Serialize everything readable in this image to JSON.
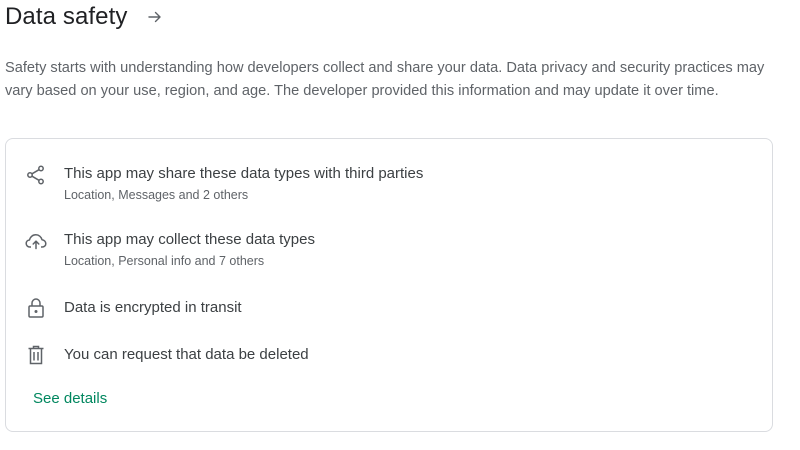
{
  "header": {
    "title": "Data safety",
    "arrow_icon": "arrow-right-icon"
  },
  "description": "Safety starts with understanding how developers collect and share your data. Data privacy and security practices may vary based on your use, region, and age. The developer provided this information and may update it over time.",
  "card": {
    "items": [
      {
        "icon": "share-icon",
        "title": "This app may share these data types with third parties",
        "subtitle": "Location, Messages and 2 others"
      },
      {
        "icon": "cloud-upload-icon",
        "title": "This app may collect these data types",
        "subtitle": "Location, Personal info and 7 others"
      },
      {
        "icon": "lock-icon",
        "title": "Data is encrypted in transit"
      },
      {
        "icon": "trash-icon",
        "title": "You can request that data be deleted"
      }
    ],
    "see_details": "See details"
  },
  "colors": {
    "link": "#01875f",
    "border": "#dadce0",
    "text_primary": "#3c4043",
    "text_secondary": "#5f6368"
  }
}
